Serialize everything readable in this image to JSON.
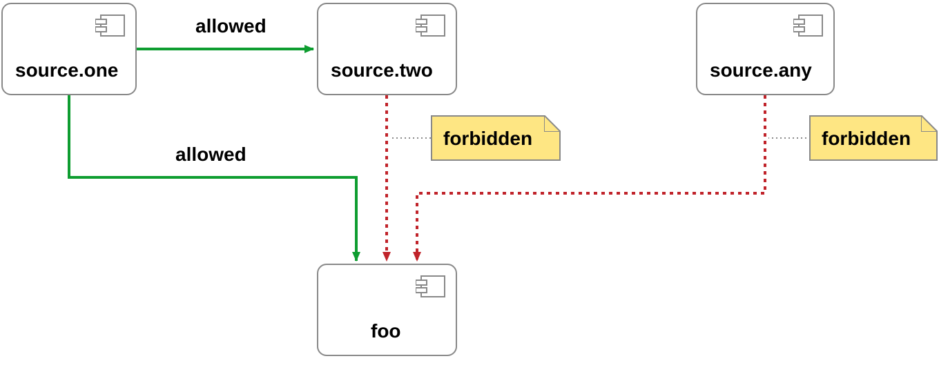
{
  "diagram": {
    "components": {
      "source_one": "source.one",
      "source_two": "source.two",
      "source_any": "source.any",
      "foo": "foo"
    },
    "notes": {
      "forbidden1": "forbidden",
      "forbidden2": "forbidden"
    },
    "edges": {
      "allowed1": "allowed",
      "allowed2": "allowed"
    },
    "colors": {
      "allowed": "#0E9D30",
      "forbidden": "#C0232A",
      "border": "#888888",
      "note_bg": "#FEE683"
    }
  }
}
